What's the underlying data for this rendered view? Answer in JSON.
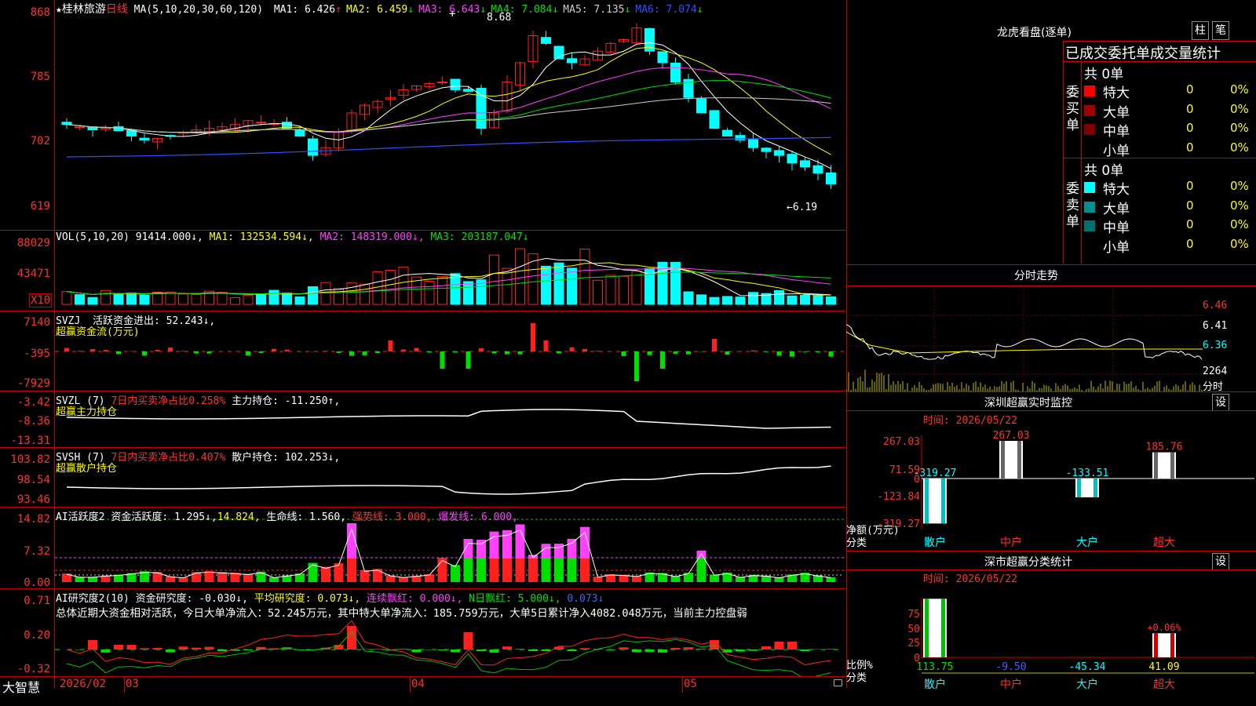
{
  "stock": {
    "name": "桂林旅游",
    "period": "日线"
  },
  "main": {
    "ma_title": "MA(5,10,20,30,60,120)",
    "ma_items": [
      {
        "label": "MA1: 6.426",
        "arrow": "↑",
        "color": "#ffffff"
      },
      {
        "label": "MA2: 6.459",
        "arrow": "↓",
        "color": "#ffff00"
      },
      {
        "label": "MA3: 6.643",
        "arrow": "↓",
        "color": "#ff40ff"
      },
      {
        "label": "MA4: 7.084",
        "arrow": "↓",
        "color": "#00e000"
      },
      {
        "label": "MA5: 7.135",
        "arrow": "↓",
        "color": "#cccccc"
      },
      {
        "label": "MA6: 7.074",
        "arrow": "↓",
        "color": "#3050ff"
      }
    ],
    "y_labels": [
      "868",
      "785",
      "702",
      "619"
    ],
    "high_mark": "8.68",
    "low_mark": "←6.19"
  },
  "vol": {
    "title": "VOL(5,10,20)",
    "value": "91414.000↓,",
    "ma1": "MA1: 132534.594↓,",
    "ma2": "MA2: 148319.000↓,",
    "ma3": "MA3: 203187.047↓",
    "y_labels": [
      "88029",
      "43471"
    ],
    "unit": "X10"
  },
  "svzj": {
    "title": "SVZJ",
    "line1": "活跃资金进出: 52.243↓,",
    "line2": "超赢资金流(万元)",
    "y_labels": [
      "7140",
      "-395",
      "-7929"
    ]
  },
  "svzl": {
    "title": "SVZL (7)",
    "part1": "7日内买卖净占比0.258%",
    "part2": "主力持仓: -11.250↑,",
    "line2": "超赢主力持仓",
    "y_labels": [
      "-3.42",
      "-8.36",
      "-13.31"
    ]
  },
  "svsh": {
    "title": "SVSH (7)",
    "part1": "7日内买卖净占比0.407%",
    "part2": "散户持仓: 102.253↓,",
    "line2": "超赢散户持仓",
    "y_labels": [
      "103.82",
      "98.54",
      "93.46"
    ]
  },
  "ai1": {
    "title": "AI活跃度2",
    "p1": "资金活跃度: 1.295↓,",
    "p2": "14.824,",
    "p3": "生命线: 1.560,",
    "p4": "强势线: 3.000,",
    "p5": "爆发线: 6.000,",
    "y_labels": [
      "14.82",
      "7.32",
      "0.00"
    ]
  },
  "ai2": {
    "title": "AI研究度2(10)",
    "p1": "资金研究度: -0.030↓,",
    "p2": "平均研究度: 0.073↓,",
    "p3": "连续飘红: 0.000↓,",
    "p4": "N日飘红: 5.000↓,",
    "p5": "0.073↓",
    "summary": "总体近期大资金相对活跃，今日大单净流入：52.245万元，其中特大单净流入：185.759万元，大单5日累计净入4082.048万元，当前主力控盘弱",
    "y_labels": [
      "0.71",
      "0.20",
      "-0.32"
    ]
  },
  "xaxis": {
    "brand": "大智慧",
    "labels": [
      "2026/02",
      "03",
      "04",
      "05"
    ]
  },
  "right": {
    "lhb_title": "龙虎看盘(逐单)",
    "btn_zhu": "柱",
    "btn_bi": "笔",
    "stat_title": "已成交委托单成交量统计",
    "buy": {
      "side_label": "委买单",
      "total": "共 0单",
      "rows": [
        {
          "name": "特大",
          "color": "#ff0000",
          "val": "0",
          "pct": "0%"
        },
        {
          "name": "大单",
          "color": "#a00000",
          "val": "0",
          "pct": "0%"
        },
        {
          "name": "中单",
          "color": "#800000",
          "val": "0",
          "pct": "0%"
        },
        {
          "name": "小单",
          "color": "",
          "val": "0",
          "pct": "0%"
        }
      ]
    },
    "sell": {
      "side_label": "委卖单",
      "total": "共 0单",
      "rows": [
        {
          "name": "特大",
          "color": "#00ffff",
          "val": "0",
          "pct": "0%"
        },
        {
          "name": "大单",
          "color": "#009090",
          "val": "0",
          "pct": "0%"
        },
        {
          "name": "中单",
          "color": "#007070",
          "val": "0",
          "pct": "0%"
        },
        {
          "name": "小单",
          "color": "",
          "val": "0",
          "pct": "0%"
        }
      ]
    },
    "fenshi": {
      "title": "分时走势",
      "y_labels": [
        "6.46",
        "6.41",
        "6.36"
      ],
      "vol_label": "2264",
      "fenshi_label": "分时"
    },
    "monitor": {
      "title": "深圳超赢实时监控",
      "set": "设",
      "date": "时间: 2026/05/22",
      "y_labels": [
        "267.03",
        "71.59",
        "0",
        "-123.84",
        "-319.27"
      ],
      "net_label": "净额(万元)",
      "cat_label": "分类",
      "bars": [
        {
          "cat": "散户",
          "value": -319.27,
          "label": "-319.27"
        },
        {
          "cat": "中户",
          "value": 267.03,
          "label": "267.03"
        },
        {
          "cat": "大户",
          "value": -133.51,
          "label": "-133.51"
        },
        {
          "cat": "超大",
          "value": 185.76,
          "label": "185.76"
        }
      ]
    },
    "classify": {
      "title": "深市超赢分类统计",
      "set": "设",
      "date": "时间: 2026/05/22",
      "y_labels": [
        "75",
        "50",
        "25",
        "0"
      ],
      "ratio_label": "比例%",
      "cat_label": "分类",
      "note": "+0.06%",
      "bars": [
        {
          "cat": "散户",
          "pct": 113.75,
          "label": "113.75"
        },
        {
          "cat": "中户",
          "pct": -9.5,
          "label": "-9.50"
        },
        {
          "cat": "大户",
          "pct": -45.34,
          "label": "-45.34"
        },
        {
          "cat": "超大",
          "pct": 41.09,
          "label": "41.09"
        }
      ]
    }
  }
}
